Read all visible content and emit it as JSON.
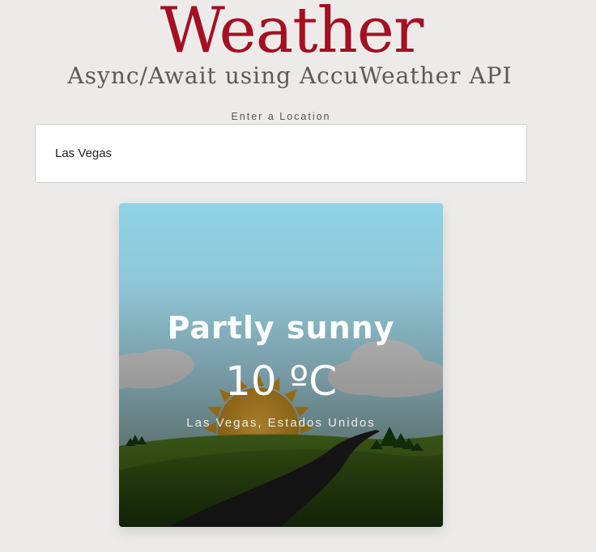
{
  "header": {
    "title": "Weather",
    "subtitle": "Async/Await using AccuWeather API"
  },
  "search": {
    "label": "Enter a Location",
    "value": "Las Vegas"
  },
  "weather_card": {
    "condition": "Partly sunny",
    "temperature": "10 ºC",
    "location": "Las Vegas, Estados Unidos",
    "scene_icon": "partly-sunny-illustration"
  },
  "colors": {
    "title": "#a40f22",
    "background": "#edebea",
    "sky_top": "#8fd3e6",
    "grass": "#3a5e14",
    "sun": "#e0a52a"
  }
}
